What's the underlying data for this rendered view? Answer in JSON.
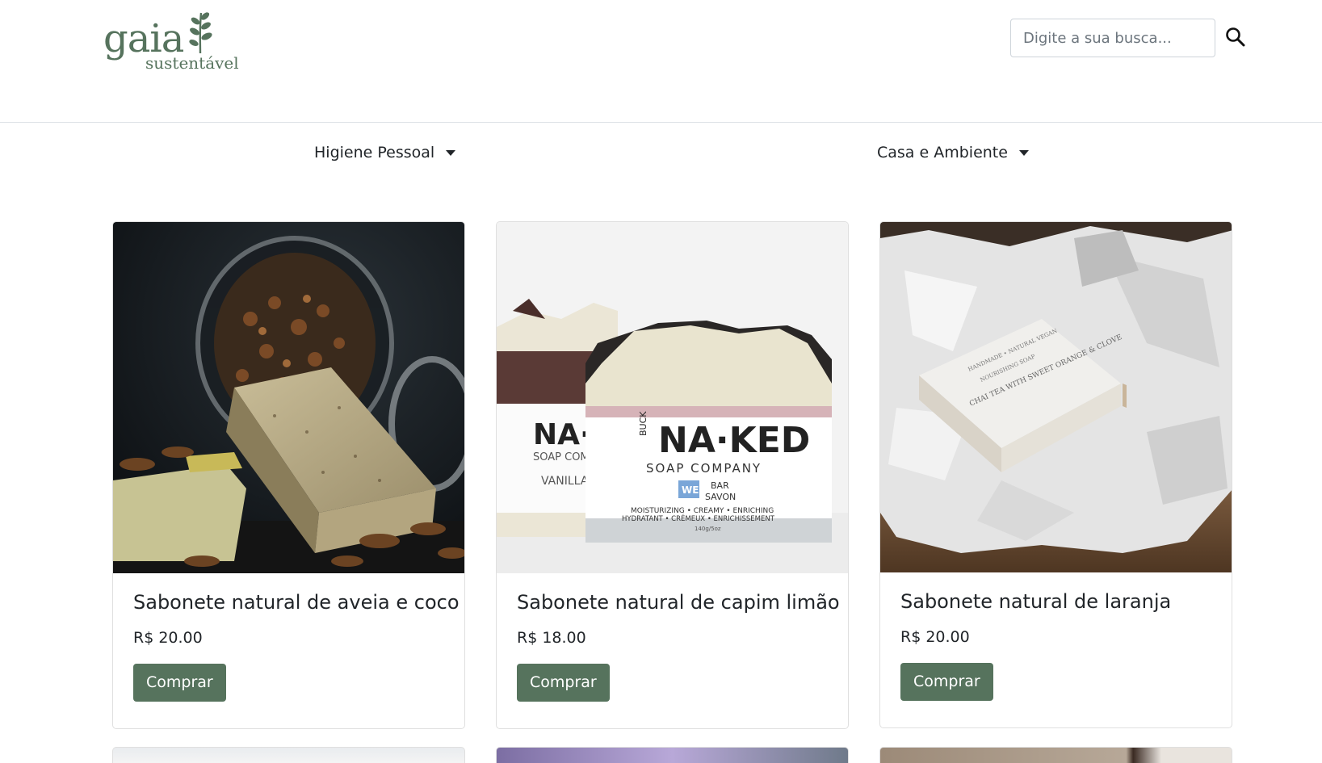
{
  "brand": {
    "name": "gaia",
    "tagline": "sustentável"
  },
  "search": {
    "placeholder": "Digite a sua busca..."
  },
  "nav": {
    "items": [
      {
        "label": "Higiene Pessoal"
      },
      {
        "label": "Casa e Ambiente"
      }
    ]
  },
  "products": [
    {
      "title": "Sabonete natural de aveia e coco",
      "price": "R$ 20.00",
      "button": "Comprar"
    },
    {
      "title": "Sabonete natural de capim limão",
      "price": "R$ 18.00",
      "button": "Comprar"
    },
    {
      "title": "Sabonete natural de laranja",
      "price": "R$ 20.00",
      "button": "Comprar"
    }
  ],
  "soap_labels": {
    "brand_small": "BUCK",
    "brand_big": "NA·KED",
    "company": "SOAP COMPANY",
    "we": "WE",
    "bar": "BAR",
    "savon": "SAVON",
    "line1": "MOISTURIZING • CREAMY • ENRICHING",
    "line2": "HYDRATANT • CRÉMEUX • ENRICHISSEMENT",
    "weight": "140g/5oz",
    "back_variant": "VANILLA",
    "orange_label": "CHAI TEA WITH SWEET ORANGE & CLOVE",
    "orange_header": "HANDMADE • NATURAL VEGAN",
    "orange_sub": "NOURISHING SOAP"
  },
  "colors": {
    "accent": "#56735d",
    "border": "#dee2e6"
  }
}
